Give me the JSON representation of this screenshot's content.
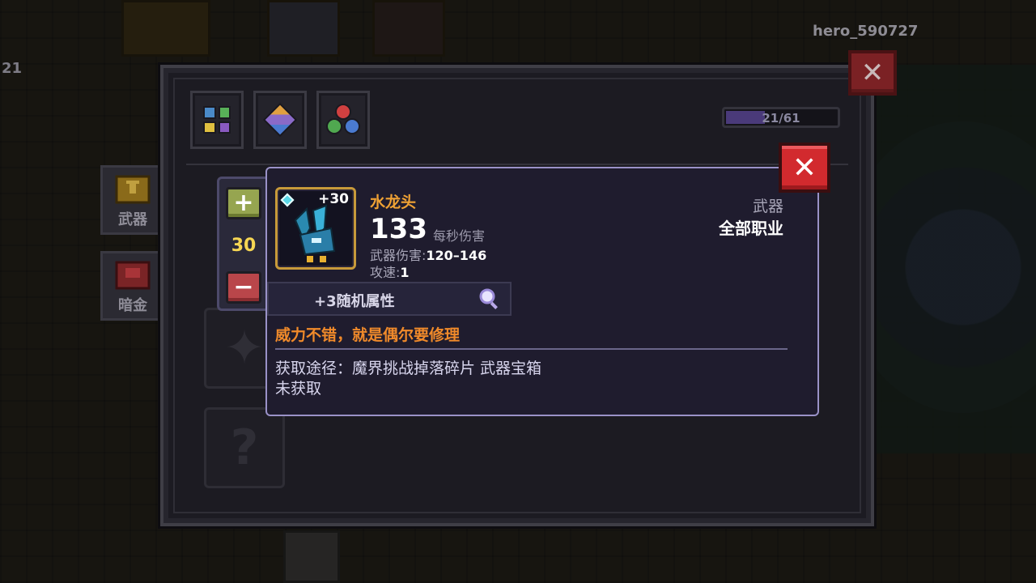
{
  "hud": {
    "player_name": "hero_590727",
    "left_counter": "21"
  },
  "panel": {
    "progress_text": "21/61",
    "progress_fraction": 0.344,
    "side_tabs": [
      {
        "label": "武器",
        "icon": "weapon-chest-icon"
      },
      {
        "label": "暗金",
        "icon": "dark-gold-chest-icon"
      }
    ],
    "category_icons": [
      "grid-category-icon",
      "gem-category-icon",
      "orbs-category-icon"
    ]
  },
  "level_selector": {
    "value": "30",
    "plus_label": "+",
    "minus_label": "−"
  },
  "item": {
    "enhance": "+30",
    "name": "水龙头",
    "dps_value": "133",
    "dps_label": "每秒伤害",
    "damage_label": "武器伤害:",
    "damage_value": "120–146",
    "speed_label": "攻速:",
    "speed_value": "1",
    "type": "武器",
    "class": "全部职业",
    "random_attr": "+3随机属性",
    "flavor": "威力不错，就是偶尔要修理",
    "source": "获取途径：魔界挑战掉落碎片 武器宝箱",
    "status": "未获取"
  },
  "colors": {
    "item_name": "#f0a234",
    "flavor": "#f08a2a",
    "level": "#f6d653",
    "close_red": "#d22a2e",
    "card_border": "#9a92c8"
  }
}
